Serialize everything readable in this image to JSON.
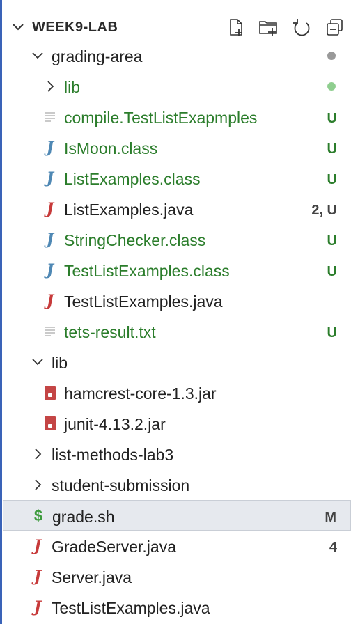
{
  "explorer": {
    "title": "WEEK9-LAB",
    "toolbar": [
      {
        "name": "new-file-icon"
      },
      {
        "name": "new-folder-icon"
      },
      {
        "name": "refresh-icon"
      },
      {
        "name": "collapse-all-icon"
      }
    ]
  },
  "tree": [
    {
      "label": "grading-area",
      "type": "folder-open",
      "indent": 1,
      "color": "#222222",
      "status": "",
      "dot": "#999999"
    },
    {
      "label": "lib",
      "type": "folder-closed",
      "indent": 2,
      "color": "#2b7d2b",
      "status": "",
      "dot": "#8fce8f"
    },
    {
      "label": "compile.TestListExapmples",
      "type": "text",
      "indent": 2,
      "color": "#2b7d2b",
      "status": "U",
      "status_color": "#2b7d2b"
    },
    {
      "label": "IsMoon.class",
      "type": "class",
      "indent": 2,
      "color": "#2b7d2b",
      "status": "U",
      "status_color": "#2b7d2b"
    },
    {
      "label": "ListExamples.class",
      "type": "class",
      "indent": 2,
      "color": "#2b7d2b",
      "status": "U",
      "status_color": "#2b7d2b"
    },
    {
      "label": "ListExamples.java",
      "type": "java",
      "indent": 2,
      "color": "#222222",
      "status": "2, U",
      "status_color": "#444444"
    },
    {
      "label": "StringChecker.class",
      "type": "class",
      "indent": 2,
      "color": "#2b7d2b",
      "status": "U",
      "status_color": "#2b7d2b"
    },
    {
      "label": "TestListExamples.class",
      "type": "class",
      "indent": 2,
      "color": "#2b7d2b",
      "status": "U",
      "status_color": "#2b7d2b"
    },
    {
      "label": "TestListExamples.java",
      "type": "java",
      "indent": 2,
      "color": "#222222",
      "status": ""
    },
    {
      "label": "tets-result.txt",
      "type": "text",
      "indent": 2,
      "color": "#2b7d2b",
      "status": "U",
      "status_color": "#2b7d2b"
    },
    {
      "label": "lib",
      "type": "folder-open",
      "indent": 1,
      "color": "#222222",
      "status": ""
    },
    {
      "label": "hamcrest-core-1.3.jar",
      "type": "jar",
      "indent": 2,
      "color": "#222222",
      "status": ""
    },
    {
      "label": "junit-4.13.2.jar",
      "type": "jar",
      "indent": 2,
      "color": "#222222",
      "status": ""
    },
    {
      "label": "list-methods-lab3",
      "type": "folder-closed",
      "indent": 1,
      "color": "#222222",
      "status": ""
    },
    {
      "label": "student-submission",
      "type": "folder-closed",
      "indent": 1,
      "color": "#222222",
      "status": ""
    },
    {
      "label": "grade.sh",
      "type": "shell",
      "indent": 1,
      "color": "#222222",
      "status": "M",
      "status_color": "#444444",
      "selected": true
    },
    {
      "label": "GradeServer.java",
      "type": "java",
      "indent": 1,
      "color": "#222222",
      "status": "4",
      "status_color": "#444444"
    },
    {
      "label": "Server.java",
      "type": "java",
      "indent": 1,
      "color": "#222222",
      "status": ""
    },
    {
      "label": "TestListExamples.java",
      "type": "java",
      "indent": 1,
      "color": "#222222",
      "status": ""
    }
  ]
}
